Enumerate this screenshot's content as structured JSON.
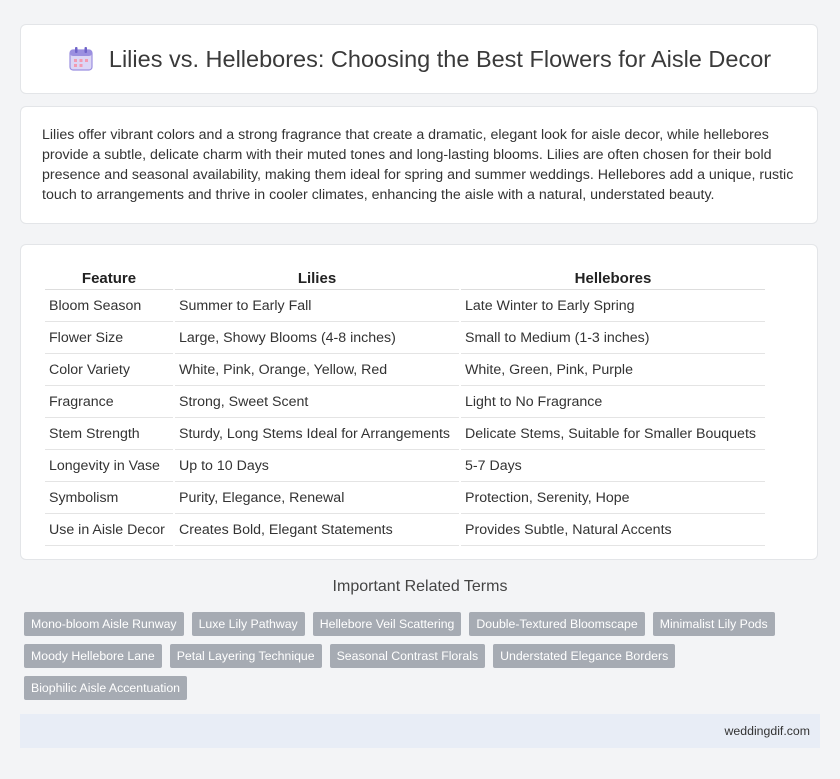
{
  "header": {
    "title": "Lilies vs. Hellebores: Choosing the Best Flowers for Aisle Decor",
    "icon": "calendar-icon"
  },
  "intro": {
    "text": "Lilies offer vibrant colors and a strong fragrance that create a dramatic, elegant look for aisle decor, while hellebores provide a subtle, delicate charm with their muted tones and long-lasting blooms. Lilies are often chosen for their bold presence and seasonal availability, making them ideal for spring and summer weddings. Hellebores add a unique, rustic touch to arrangements and thrive in cooler climates, enhancing the aisle with a natural, understated beauty."
  },
  "table": {
    "headers": [
      "Feature",
      "Lilies",
      "Hellebores"
    ],
    "rows": [
      [
        "Bloom Season",
        "Summer to Early Fall",
        "Late Winter to Early Spring"
      ],
      [
        "Flower Size",
        "Large, Showy Blooms (4-8 inches)",
        "Small to Medium (1-3 inches)"
      ],
      [
        "Color Variety",
        "White, Pink, Orange, Yellow, Red",
        "White, Green, Pink, Purple"
      ],
      [
        "Fragrance",
        "Strong, Sweet Scent",
        "Light to No Fragrance"
      ],
      [
        "Stem Strength",
        "Sturdy, Long Stems Ideal for Arrangements",
        "Delicate Stems, Suitable for Smaller Bouquets"
      ],
      [
        "Longevity in Vase",
        "Up to 10 Days",
        "5-7 Days"
      ],
      [
        "Symbolism",
        "Purity, Elegance, Renewal",
        "Protection, Serenity, Hope"
      ],
      [
        "Use in Aisle Decor",
        "Creates Bold, Elegant Statements",
        "Provides Subtle, Natural Accents"
      ]
    ]
  },
  "related": {
    "title": "Important Related Terms",
    "tags": [
      "Mono-bloom Aisle Runway",
      "Luxe Lily Pathway",
      "Hellebore Veil Scattering",
      "Double-Textured Bloomscape",
      "Minimalist Lily Pods",
      "Moody Hellebore Lane",
      "Petal Layering Technique",
      "Seasonal Contrast Florals",
      "Understated Elegance Borders",
      "Biophilic Aisle Accentuation"
    ]
  },
  "footer": {
    "site": "weddingdif.com"
  }
}
